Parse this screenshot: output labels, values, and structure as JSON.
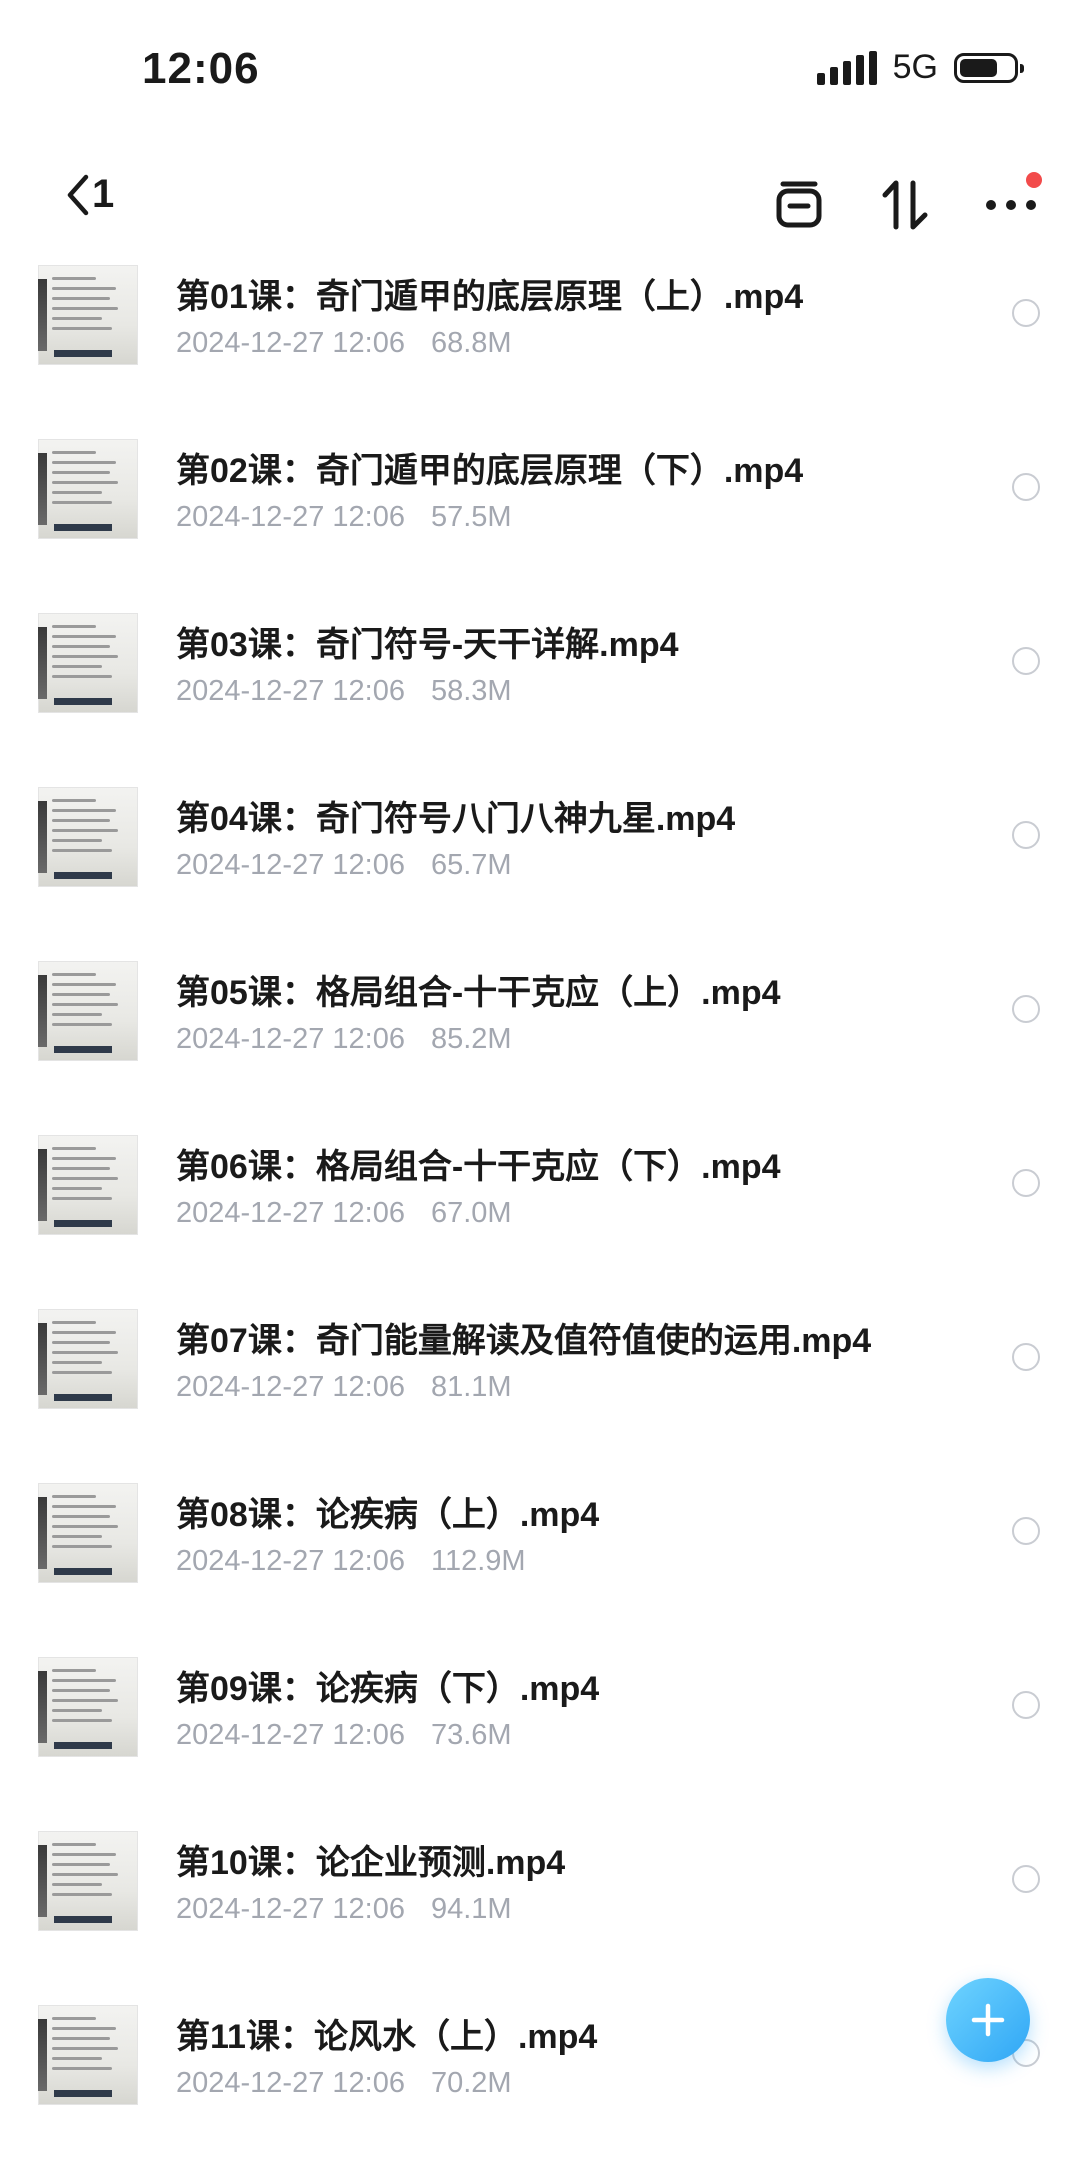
{
  "status_bar": {
    "time": "12:06",
    "network": "5G",
    "battery_level": 0.72
  },
  "nav": {
    "back_count": "1",
    "icons": [
      "back-chevron-icon",
      "inbox-icon",
      "sort-icon",
      "more-icon"
    ],
    "has_notification_dot": true,
    "accent_color": "#2fa6f5",
    "badge_color": "#f24b4b"
  },
  "files": [
    {
      "name": "第01课：奇门遁甲的底层原理（上）.mp4",
      "date": "2024-12-27 12:06",
      "size": "68.8M"
    },
    {
      "name": "第02课：奇门遁甲的底层原理（下）.mp4",
      "date": "2024-12-27 12:06",
      "size": "57.5M"
    },
    {
      "name": "第03课：奇门符号-天干详解.mp4",
      "date": "2024-12-27 12:06",
      "size": "58.3M"
    },
    {
      "name": "第04课：奇门符号八门八神九星.mp4",
      "date": "2024-12-27 12:06",
      "size": "65.7M"
    },
    {
      "name": "第05课：格局组合-十干克应（上）.mp4",
      "date": "2024-12-27 12:06",
      "size": "85.2M"
    },
    {
      "name": "第06课：格局组合-十干克应（下）.mp4",
      "date": "2024-12-27 12:06",
      "size": "67.0M"
    },
    {
      "name": "第07课：奇门能量解读及值符值使的运用.mp4",
      "date": "2024-12-27 12:06",
      "size": "81.1M"
    },
    {
      "name": "第08课：论疾病（上）.mp4",
      "date": "2024-12-27 12:06",
      "size": "112.9M"
    },
    {
      "name": "第09课：论疾病（下）.mp4",
      "date": "2024-12-27 12:06",
      "size": "73.6M"
    },
    {
      "name": "第10课：论企业预测.mp4",
      "date": "2024-12-27 12:06",
      "size": "94.1M"
    },
    {
      "name": "第11课：论风水（上）.mp4",
      "date": "2024-12-27 12:06",
      "size": "70.2M"
    }
  ],
  "fab": {
    "icon": "plus-icon"
  }
}
